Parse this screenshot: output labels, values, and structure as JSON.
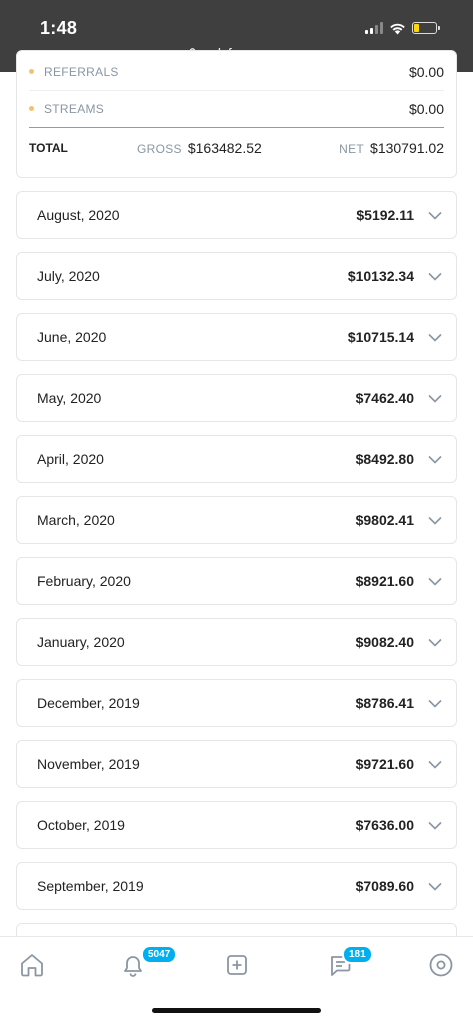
{
  "status": {
    "time": "1:48",
    "url": "onlyfans.com"
  },
  "summary": {
    "referrals": {
      "label": "REFERRALS",
      "value": "$0.00"
    },
    "streams": {
      "label": "STREAMS",
      "value": "$0.00"
    },
    "total": {
      "label": "TOTAL",
      "gross_label": "GROSS",
      "gross_value": "$163482.52",
      "net_label": "NET",
      "net_value": "$130791.02"
    }
  },
  "months": [
    {
      "label": "August, 2020",
      "value": "$5192.11"
    },
    {
      "label": "July, 2020",
      "value": "$10132.34"
    },
    {
      "label": "June, 2020",
      "value": "$10715.14"
    },
    {
      "label": "May, 2020",
      "value": "$7462.40"
    },
    {
      "label": "April, 2020",
      "value": "$8492.80"
    },
    {
      "label": "March, 2020",
      "value": "$9802.41"
    },
    {
      "label": "February, 2020",
      "value": "$8921.60"
    },
    {
      "label": "January, 2020",
      "value": "$9082.40"
    },
    {
      "label": "December, 2019",
      "value": "$8786.41"
    },
    {
      "label": "November, 2019",
      "value": "$9721.60"
    },
    {
      "label": "October, 2019",
      "value": "$7636.00"
    },
    {
      "label": "September, 2019",
      "value": "$7089.60"
    }
  ],
  "nav": {
    "notifications_badge": "5047",
    "messages_badge": "181",
    "icons": [
      "home-icon",
      "bell-icon",
      "add-post-icon",
      "messages-icon",
      "profile-icon"
    ]
  },
  "colors": {
    "accent": "#00aff0",
    "divider_accent": "#36c0d6",
    "stream_dot": "#f5c26b"
  }
}
